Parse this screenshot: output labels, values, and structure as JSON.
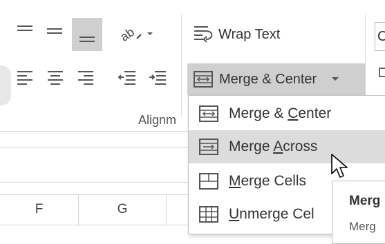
{
  "ribbon": {
    "wrap_text_label": "Wrap Text",
    "merge_center_label": "Merge & Center",
    "group_label": "Alignm"
  },
  "merge_menu": {
    "items": [
      {
        "prefix": "Merge & ",
        "underline": "C",
        "suffix": "enter",
        "icon": "merge-center-icon"
      },
      {
        "prefix": "Merge ",
        "underline": "A",
        "suffix": "cross",
        "icon": "merge-across-icon"
      },
      {
        "prefix": "",
        "underline": "M",
        "suffix": "erge Cells",
        "icon": "merge-cells-icon"
      },
      {
        "prefix": "",
        "underline": "U",
        "suffix": "nmerge Cel",
        "icon": "unmerge-cells-icon"
      }
    ],
    "hovered_index": 1
  },
  "sheet": {
    "columns": [
      "F",
      "G"
    ]
  },
  "tooltip": {
    "title": "Merg",
    "text": "Merg"
  },
  "colors": {
    "selected_button_bg": "#cfcfcf",
    "menu_hover_bg": "#dcdcdc",
    "grid_line": "#d6d6d6"
  }
}
